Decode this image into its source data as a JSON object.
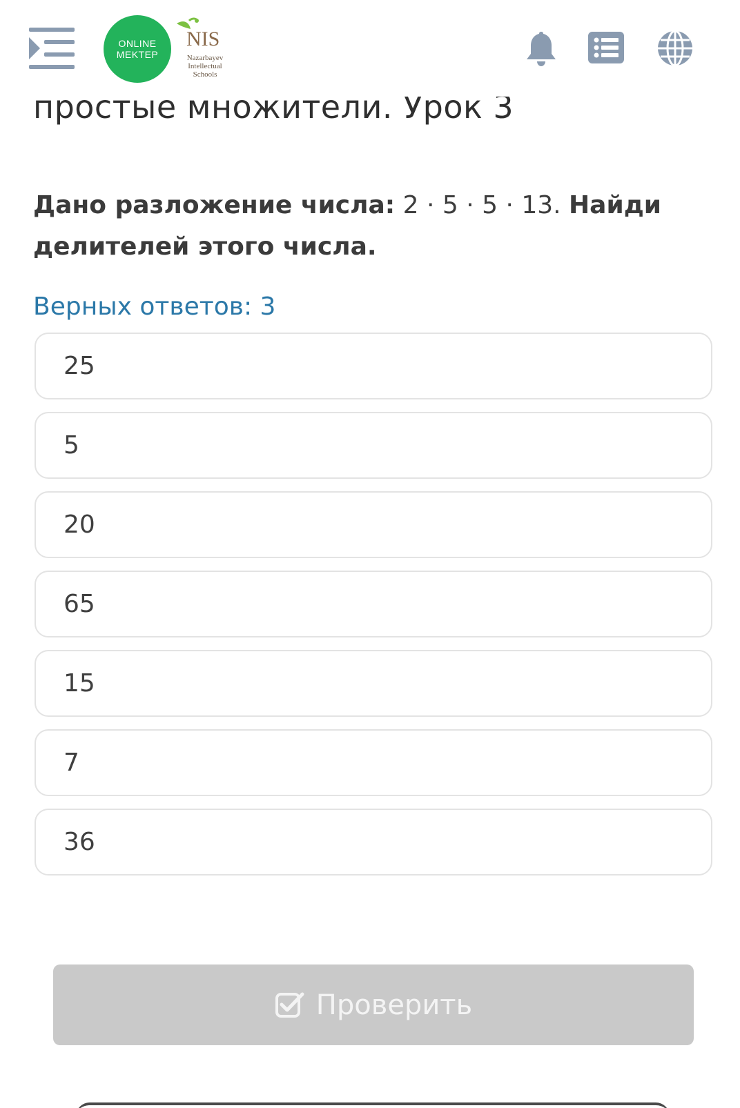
{
  "header": {
    "lesson_title": "простые множители. Урок 3",
    "logo_online_line1": "ONLINE",
    "logo_online_line2": "MEKTEP",
    "logo_nis_mark": "NIS",
    "logo_nis_sub1": "Nazarbayev",
    "logo_nis_sub2": "Intellectual",
    "logo_nis_sub3": "Schools",
    "icons": [
      "menu-icon",
      "bell-icon",
      "list-icon",
      "globe-icon"
    ]
  },
  "question": {
    "prefix_bold": "Дано разложение числа:",
    "expression": " 2 · 5 · 5 · 13. ",
    "suffix_bold": "Найди делителей этого числа."
  },
  "correct_count_label": "Верных ответов: 3",
  "options": [
    {
      "label": "25"
    },
    {
      "label": "5"
    },
    {
      "label": "20"
    },
    {
      "label": "65"
    },
    {
      "label": "15"
    },
    {
      "label": "7"
    },
    {
      "label": "36"
    }
  ],
  "check_button": {
    "label": "Проверить"
  },
  "colors": {
    "accent_green": "#23b35b",
    "link_blue": "#2b78a8",
    "icon_slate": "#8a9bb0",
    "button_disabled": "#c9c9c9"
  }
}
